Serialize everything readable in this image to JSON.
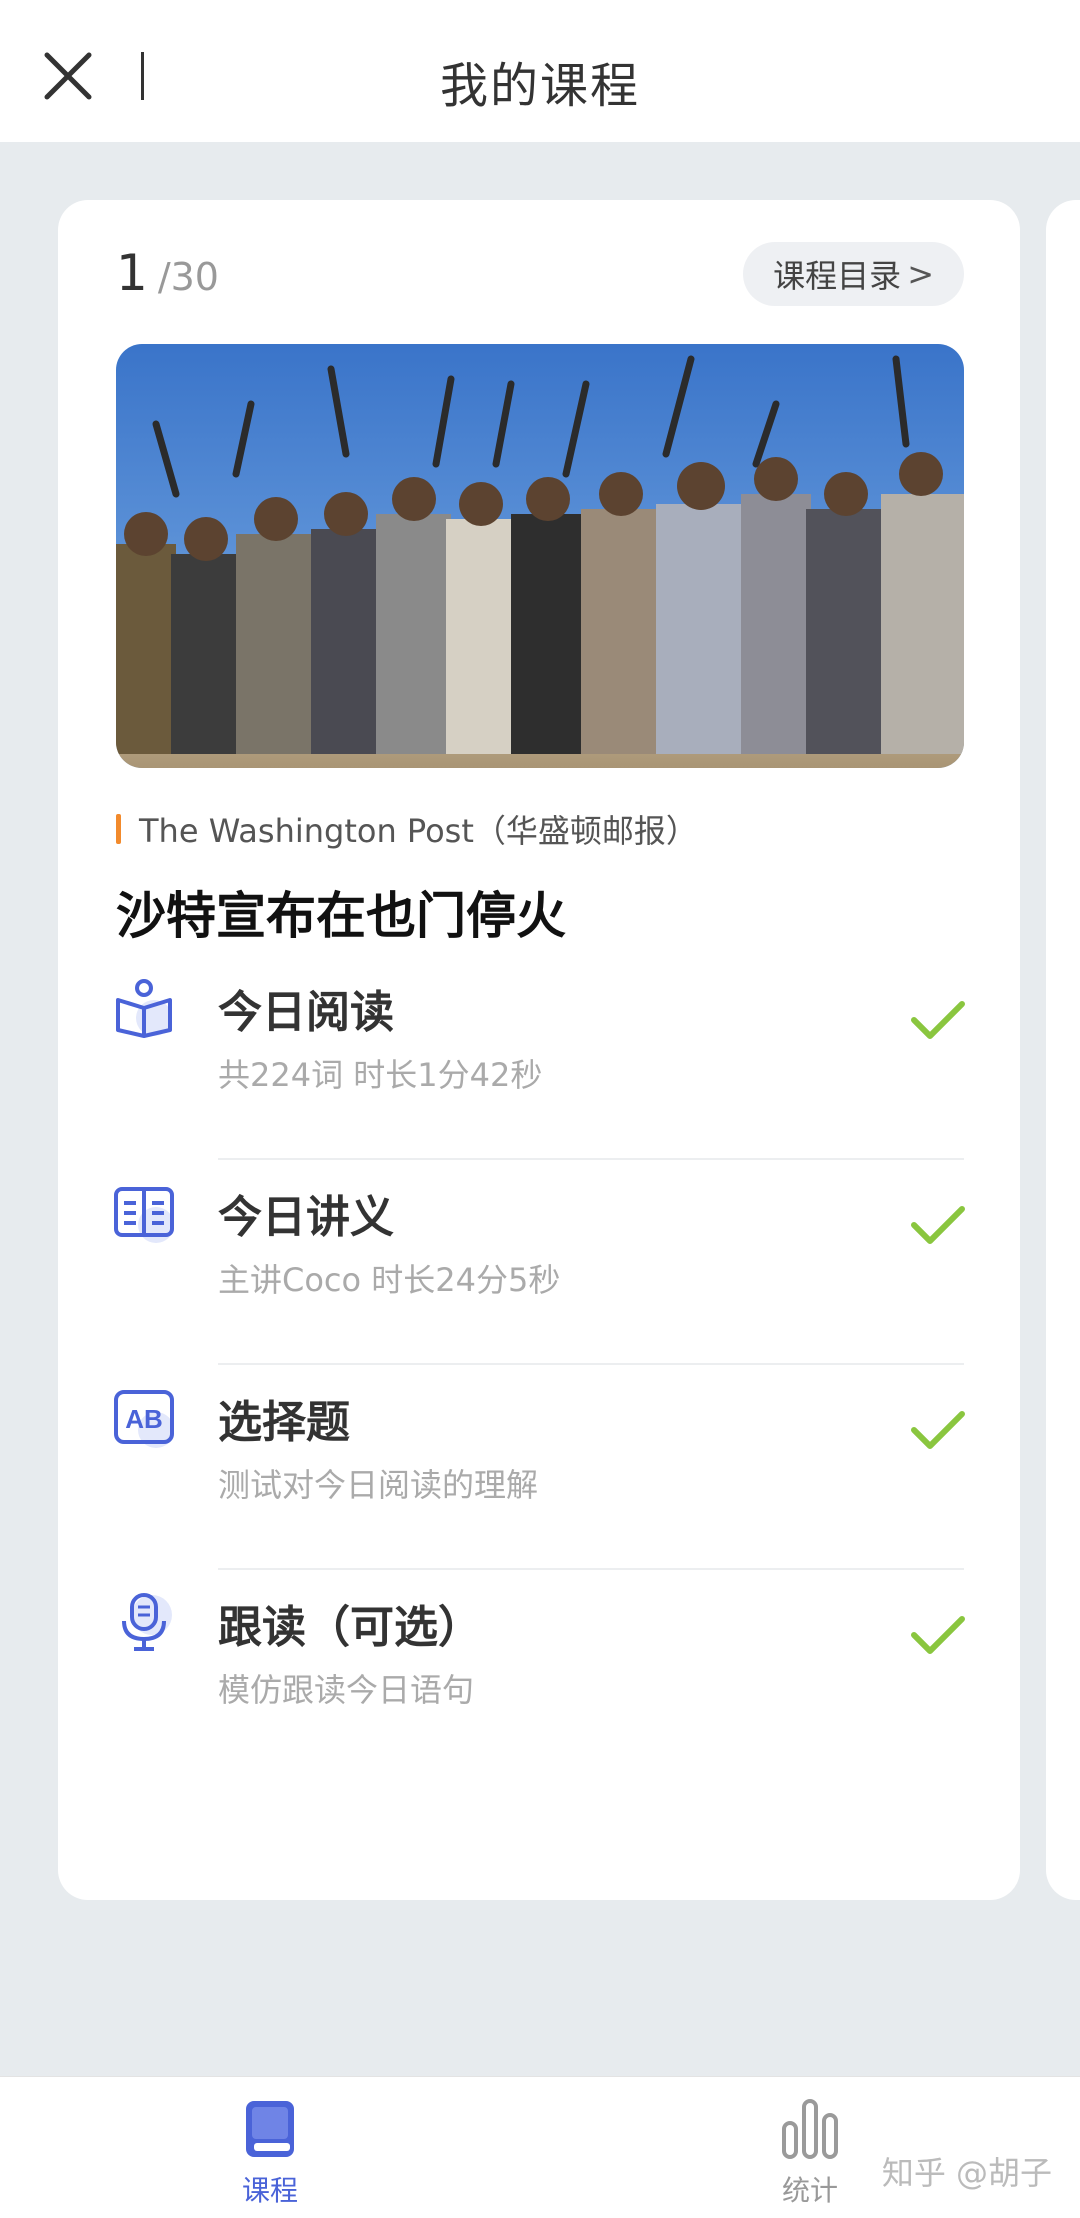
{
  "header": {
    "title": "我的课程",
    "close_icon": "close-icon"
  },
  "card": {
    "counter_current": "1",
    "counter_total": "/30",
    "catalog_label": "课程目录",
    "catalog_chevron": ">",
    "hero_image": "photo of a crowd of armed men in traditional dress raising rifles",
    "source": "The Washington Post（华盛顿邮报）",
    "article_title": "沙特宣布在也门停火",
    "tasks": [
      {
        "title": "今日阅读",
        "subtitle": "共224词 时长1分42秒",
        "icon": "book-reading-icon",
        "done": true
      },
      {
        "title": "今日讲义",
        "subtitle": "主讲Coco 时长24分5秒",
        "icon": "open-book-icon",
        "done": true
      },
      {
        "title": "选择题",
        "subtitle": "测试对今日阅读的理解",
        "icon": "ab-choice-icon",
        "done": true
      },
      {
        "title": "跟读（可选）",
        "subtitle": "模仿跟读今日语句",
        "icon": "microphone-icon",
        "done": true
      }
    ]
  },
  "bottom_nav": {
    "items": [
      {
        "label": "课程",
        "icon": "book-icon",
        "active": true
      },
      {
        "label": "统计",
        "icon": "bar-chart-icon",
        "active": false
      }
    ]
  },
  "watermark": "知乎 @胡子",
  "colors": {
    "accent": "#4a63d8",
    "check": "#8ac63f",
    "source_bar": "#f28a2c",
    "background": "#e7ebee"
  }
}
